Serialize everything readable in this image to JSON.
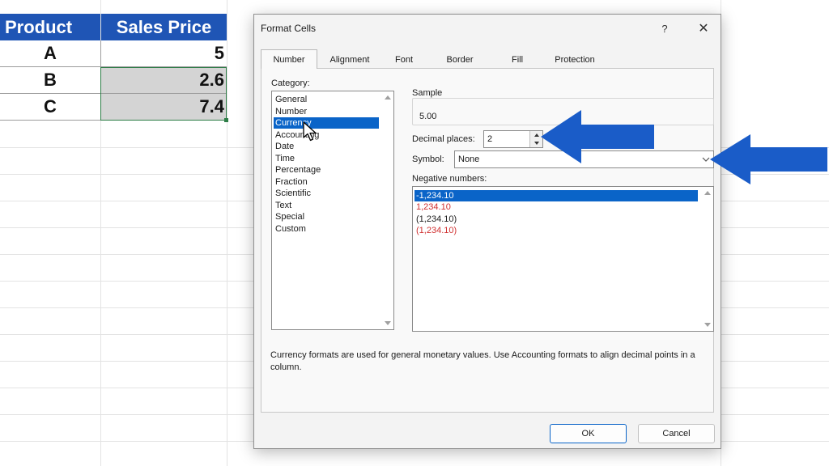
{
  "sheet": {
    "headers": [
      "Product",
      "Sales Price"
    ],
    "rows": [
      {
        "product": "A",
        "price": "5"
      },
      {
        "product": "B",
        "price": "2.6"
      },
      {
        "product": "C",
        "price": "7.4"
      }
    ],
    "header_color": "#1f55b5",
    "selection_color": "#2d7d46"
  },
  "dialog": {
    "title": "Format Cells",
    "help_icon": "question-icon",
    "close_icon": "close-icon",
    "tabs": [
      "Number",
      "Alignment",
      "Font",
      "Border",
      "Fill",
      "Protection"
    ],
    "active_tab": "Number",
    "category_label": "Category:",
    "categories": [
      "General",
      "Number",
      "Currency",
      "Accounting",
      "Date",
      "Time",
      "Percentage",
      "Fraction",
      "Scientific",
      "Text",
      "Special",
      "Custom"
    ],
    "selected_category": "Currency",
    "sample_label": "Sample",
    "sample_value": "5.00",
    "decimal_label": "Decimal places:",
    "decimal_value": "2",
    "symbol_label": "Symbol:",
    "symbol_value": "None",
    "negative_label": "Negative numbers:",
    "negative_numbers": [
      {
        "text": "-1,234.10",
        "red": false
      },
      {
        "text": "1,234.10",
        "red": true
      },
      {
        "text": "(1,234.10)",
        "red": false
      },
      {
        "text": "(1,234.10)",
        "red": true
      }
    ],
    "selected_negative": "-1,234.10",
    "description": "Currency formats are used for general monetary values.  Use Accounting formats to align decimal points in a column.",
    "ok_label": "OK",
    "cancel_label": "Cancel",
    "selection_color": "#0a64c8",
    "negative_red": "#d03030"
  },
  "annotations": {
    "arrow_color": "#1a5cc8"
  }
}
